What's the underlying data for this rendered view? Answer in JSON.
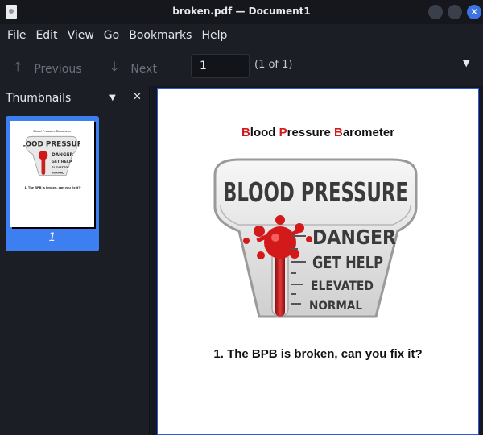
{
  "window": {
    "title": "broken.pdf — Document1",
    "close_glyph": "✕"
  },
  "menu": [
    "File",
    "Edit",
    "View",
    "Go",
    "Bookmarks",
    "Help"
  ],
  "toolbar": {
    "previous_label": "Previous",
    "next_label": "Next",
    "page_value": "1",
    "page_count": "(1 of 1)"
  },
  "sidebar": {
    "title": "Thumbnails",
    "thumbnail_page_number": "1"
  },
  "document": {
    "title_parts": [
      {
        "cap": "B",
        "rest": "lood "
      },
      {
        "cap": "P",
        "rest": "ressure "
      },
      {
        "cap": "B",
        "rest": "arometer"
      }
    ],
    "image_text": {
      "header": "BLOOD PRESSURE",
      "levels": [
        "DANGER",
        "GET HELP",
        "ELEVATED",
        "NORMAL"
      ]
    },
    "question": "1. The BPB is broken, can you fix it?"
  },
  "colors": {
    "accent_blue": "#3d7ef0",
    "title_red": "#d11a1a",
    "bg_dark": "#1b1e25"
  }
}
